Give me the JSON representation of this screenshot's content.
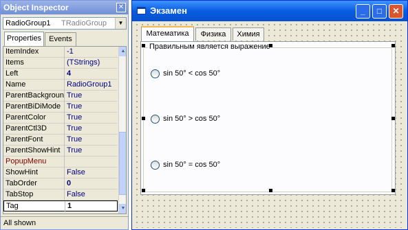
{
  "inspector": {
    "title": "Object Inspector",
    "close_glyph": "✕",
    "component_name": "RadioGroup1",
    "component_type": "TRadioGroup",
    "dropdown_glyph": "▼",
    "tabs": {
      "properties": "Properties",
      "events": "Events"
    },
    "properties": [
      {
        "name": "ItemIndex",
        "value": "-1"
      },
      {
        "name": "Items",
        "value": "(TStrings)"
      },
      {
        "name": "Left",
        "value": "4"
      },
      {
        "name": "Name",
        "value": "RadioGroup1"
      },
      {
        "name": "ParentBackground",
        "value": "True"
      },
      {
        "name": "ParentBiDiMode",
        "value": "True"
      },
      {
        "name": "ParentColor",
        "value": "True"
      },
      {
        "name": "ParentCtl3D",
        "value": "True"
      },
      {
        "name": "ParentFont",
        "value": "True"
      },
      {
        "name": "ParentShowHint",
        "value": "True"
      },
      {
        "name": "PopupMenu",
        "value": ""
      },
      {
        "name": "ShowHint",
        "value": "False"
      },
      {
        "name": "TabOrder",
        "value": "0"
      },
      {
        "name": "TabStop",
        "value": "False"
      },
      {
        "name": "Tag",
        "value": "1"
      }
    ],
    "scroll_up_glyph": "▲",
    "scroll_down_glyph": "▼",
    "status": "All shown"
  },
  "form": {
    "title": "Экзамен",
    "min_glyph": "_",
    "max_glyph": "□",
    "close_glyph": "✕",
    "tabs": [
      "Математика",
      "Физика",
      "Химия"
    ],
    "group_caption": "Правильным является выражение",
    "options": [
      "sin 50° < cos 50°",
      "sin 50° > cos 50°",
      "sin 50° = cos 50°"
    ]
  },
  "colors": {
    "inspector_title": "#7f99dc",
    "form_title": "#0a5ce0",
    "value_text": "#000080",
    "event_text": "#800000",
    "close_button": "#d8572e"
  }
}
